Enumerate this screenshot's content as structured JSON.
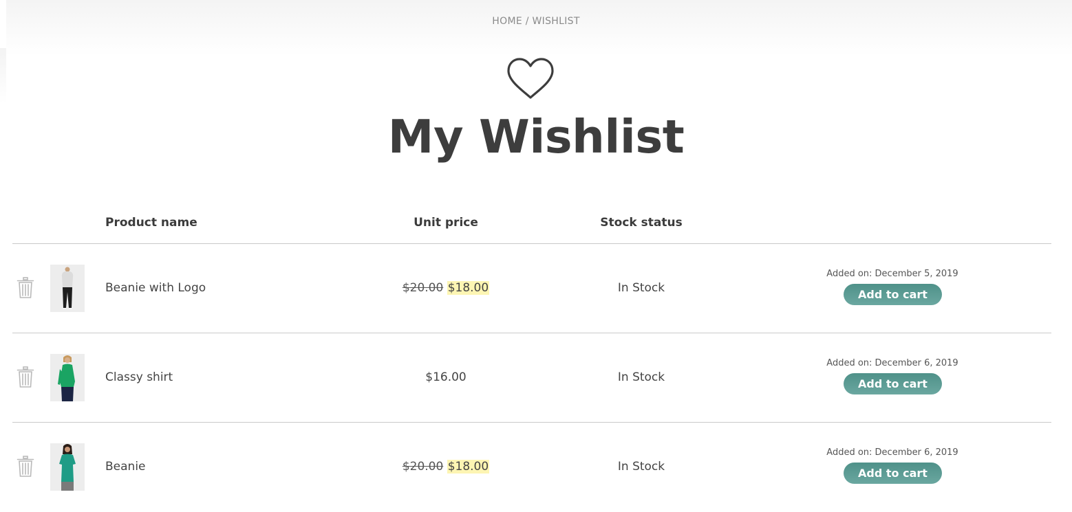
{
  "breadcrumb": {
    "home": "HOME",
    "separator": "/",
    "current": "WISHLIST"
  },
  "page": {
    "icon": "heart-outline-icon",
    "title": "My Wishlist"
  },
  "table": {
    "headers": {
      "product_name": "Product name",
      "unit_price": "Unit price",
      "stock_status": "Stock status"
    },
    "rows": [
      {
        "name": "Beanie with Logo",
        "thumbnail": "model-white-top-black-pants",
        "regular_price": "$20.00",
        "sale_price": "$18.00",
        "stock": "In Stock",
        "added_on": "Added on: December 5, 2019",
        "button_label": "Add to cart"
      },
      {
        "name": "Classy shirt",
        "thumbnail": "model-green-shirt-navy-pants",
        "price": "$16.00",
        "stock": "In Stock",
        "added_on": "Added on: December 6, 2019",
        "button_label": "Add to cart"
      },
      {
        "name": "Beanie",
        "thumbnail": "model-teal-top",
        "regular_price": "$20.00",
        "sale_price": "$18.00",
        "stock": "In Stock",
        "added_on": "Added on: December 6, 2019",
        "button_label": "Add to cart"
      }
    ]
  },
  "colors": {
    "button": "#5a9a92",
    "sale_highlight": "#fdf5b3",
    "text": "#3d3d3d",
    "divider": "#c9c9c9"
  }
}
